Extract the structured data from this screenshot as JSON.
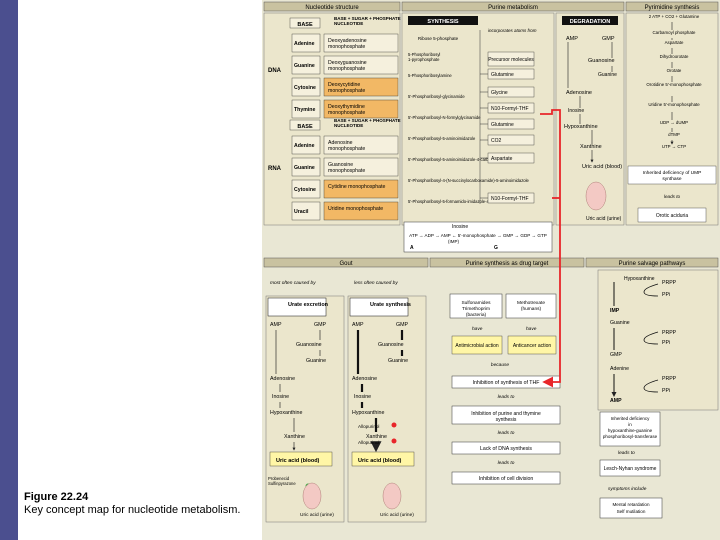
{
  "caption": {
    "figure": "Figure 22.24",
    "text": "Key concept map for nucleotide metabolism."
  },
  "headers": {
    "nucleotide_structure": "Nucleotide structure",
    "purine_metabolism": "Purine metabolism",
    "pyrimidine_synthesis": "Pyrimidine synthesis",
    "synthesis": "SYNTHESIS",
    "degradation": "DEGRADATION",
    "gout": "Gout",
    "purine_drug_target": "Purine synthesis as drug target",
    "purine_salvage": "Purine salvage pathways"
  },
  "structure": {
    "base": "BASE",
    "dna_formula": "BASE + SUGAR + PHOSPHATE = NUCLEOTIDE",
    "rna_formula": "BASE + SUGAR + PHOSPHATE = NUCLEOTIDE",
    "dna_label": "DNA",
    "rna_label": "RNA",
    "dna_rows": [
      {
        "base": "Adenine",
        "nucleotide": "Deoxyadenosine monophosphate"
      },
      {
        "base": "Guanine",
        "nucleotide": "Deoxyguanosine monophosphate"
      },
      {
        "base": "Cytosine",
        "nucleotide": "Deoxycytidine monophosphate"
      },
      {
        "base": "Thymine",
        "nucleotide": "Deoxythymidine monophosphate"
      }
    ],
    "rna_rows": [
      {
        "base": "Adenine",
        "nucleotide": "Adenosine monophosphate"
      },
      {
        "base": "Guanine",
        "nucleotide": "Guanosine monophosphate"
      },
      {
        "base": "Cytosine",
        "nucleotide": "Cytidine monophosphate"
      },
      {
        "base": "Uracil",
        "nucleotide": "Uridine monophosphate"
      }
    ]
  },
  "synthesis": {
    "incorporates": "incorporates atoms from",
    "ribose": "Ribose 5-phosphate",
    "precursor": "Precursor molecules",
    "glutamine_1": "Glutamine",
    "glycine": "Glycine",
    "n10_1": "N10-Formyl-THF",
    "glutamine_2": "Glutamine",
    "co2": "CO2",
    "aspartate": "Aspartate",
    "n10_2": "N10-Formyl-THF",
    "steps": [
      "5-Phosphoribosyl 1-pyrophosphate",
      "5-Phosphoribosylamine",
      "5'-Phosphoribosyl-glycinamide",
      "5'-Phosphoribosyl-N-formylglycinamide",
      "5'-Phosphoribosyl-5-aminoimidazole",
      "5'-Phosphoribosyl-5-aminoimidazole-4-carboxylate",
      "5'-Phosphoribosyl-4-(N-succinylocarboxamide)-5-aminoimidazole",
      "5'-Phosphoribosyl-5-formamido-imidazole-4-carboxamide"
    ],
    "inosine": "Inosine",
    "atp_line": "ATP → ADP → AMP ← 5'-monophosphate → GMP → GDP → GTP",
    "imp": "(IMP)",
    "a": "A",
    "g": "G"
  },
  "degradation": {
    "amp": "AMP",
    "gmp": "GMP",
    "guanosine": "Guanosine",
    "guanine": "Guanine",
    "adenosine": "Adenosine",
    "inosine": "Inosine",
    "hypoxanthine": "Hypoxanthine",
    "xanthine": "Xanthine",
    "uric_acid": "Uric acid (blood)",
    "uric_acid_urine": "Uric acid (urine)"
  },
  "pyrimidine": {
    "items": [
      "2 ATP + CO2 + Glutamine",
      "Carbamoyl phosphate",
      "Aspartate",
      "Dihydroorotate",
      "Orotate",
      "Orotidine 5'-monophosphate",
      "Uridine 5'-monophosphate",
      "UDP → dUMP",
      "dTMP",
      "UTP → CTP"
    ],
    "inherited": "Inherited deficiency of UMP synthase",
    "leads_to": "leads to",
    "orotic": "Orotic aciduria"
  },
  "gout": {
    "most_often": "most often caused by",
    "less_often": "less often caused by",
    "urate_excretion": "Urate excretion",
    "urate_synthesis": "Urate synthesis",
    "amp": "AMP",
    "gmp": "GMP",
    "guanosine": "Guanosine",
    "guanine": "Guanine",
    "adenosine": "Adenosine",
    "inosine": "Inosine",
    "hypoxanthine": "Hypoxanthine",
    "xanthine": "Xanthine",
    "allopurinol": "Allopurinol",
    "uric_acid": "Uric acid (blood)",
    "probenecid": "Probenecid Sulfinpyrazone",
    "uric_acid_urine": "Uric acid (urine)"
  },
  "drug": {
    "sulfonamides": "Sulfonamides Trimethoprim (bacteria)",
    "methotrexate": "Methotrexate (humans)",
    "have": "have",
    "antimicrobial": "Antimicrobial action",
    "anticancer": "Anticancer action",
    "because": "because",
    "inhibition_thf": "Inhibition of synthesis of THF",
    "leads_to": "leads to",
    "inhibition_purine": "Inhibition of purine and thymine synthesis",
    "lack_dna": "Lack of DNA synthesis",
    "inhibition_cell": "Inhibition of cell division"
  },
  "salvage": {
    "hypoxanthine": "Hypoxanthine",
    "prpp": "PRPP",
    "ppi": "PPi",
    "imp": "IMP",
    "guanine": "Guanine",
    "gmp": "GMP",
    "adenine": "Adenine",
    "amp": "AMP",
    "inherited": "Inherited deficiency in hypoxanthine-guanine phosphoribosyl-transferase",
    "leads_to": "leads to",
    "lesch": "Lesch-Nyhan syndrome",
    "symptoms": "symptoms include",
    "self_mutilation": "Mental retardation Self mutilation"
  },
  "colors": {
    "panel_bg": "#e9e7d4",
    "tan": "#c9c2a0",
    "orange": "#f2b865",
    "yellow": "#fff6a6",
    "red_arrow": "#e8262a",
    "sidebar": "#4b4f8f"
  }
}
